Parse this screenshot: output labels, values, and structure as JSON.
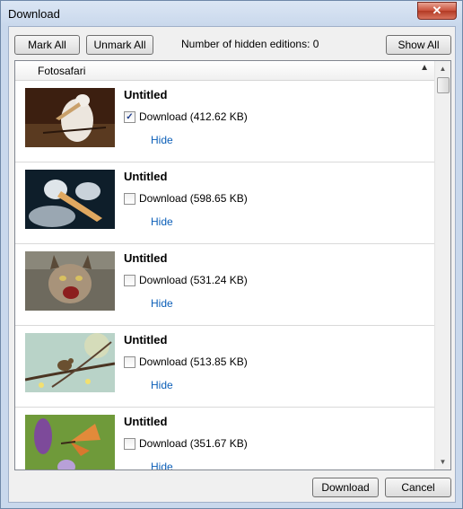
{
  "window": {
    "title": "Download"
  },
  "toolbar": {
    "mark_all": "Mark All",
    "unmark_all": "Unmark All",
    "hidden_label": "Number of hidden editions: 0",
    "show_all": "Show All"
  },
  "group": {
    "label": "Fotosafari"
  },
  "items": [
    {
      "title": "Untitled",
      "download_label": "Download (412.62 KB)",
      "checked": true,
      "hide": "Hide",
      "image": "pelican-photo"
    },
    {
      "title": "Untitled",
      "download_label": "Download (598.65 KB)",
      "checked": false,
      "hide": "Hide",
      "image": "pelican-closeup-photo"
    },
    {
      "title": "Untitled",
      "download_label": "Download (531.24 KB)",
      "checked": false,
      "hide": "Hide",
      "image": "lynx-photo"
    },
    {
      "title": "Untitled",
      "download_label": "Download (513.85 KB)",
      "checked": false,
      "hide": "Hide",
      "image": "bird-on-branch-photo"
    },
    {
      "title": "Untitled",
      "download_label": "Download (351.67 KB)",
      "checked": false,
      "hide": "Hide",
      "image": "butterfly-photo"
    }
  ],
  "footer": {
    "download": "Download",
    "cancel": "Cancel"
  },
  "icons": {
    "close": "close-icon",
    "collapse": "chevron-up-icon",
    "check": "checkmark-icon"
  },
  "colors": {
    "link": "#0c5fb8",
    "close_button": "#c9503a"
  }
}
